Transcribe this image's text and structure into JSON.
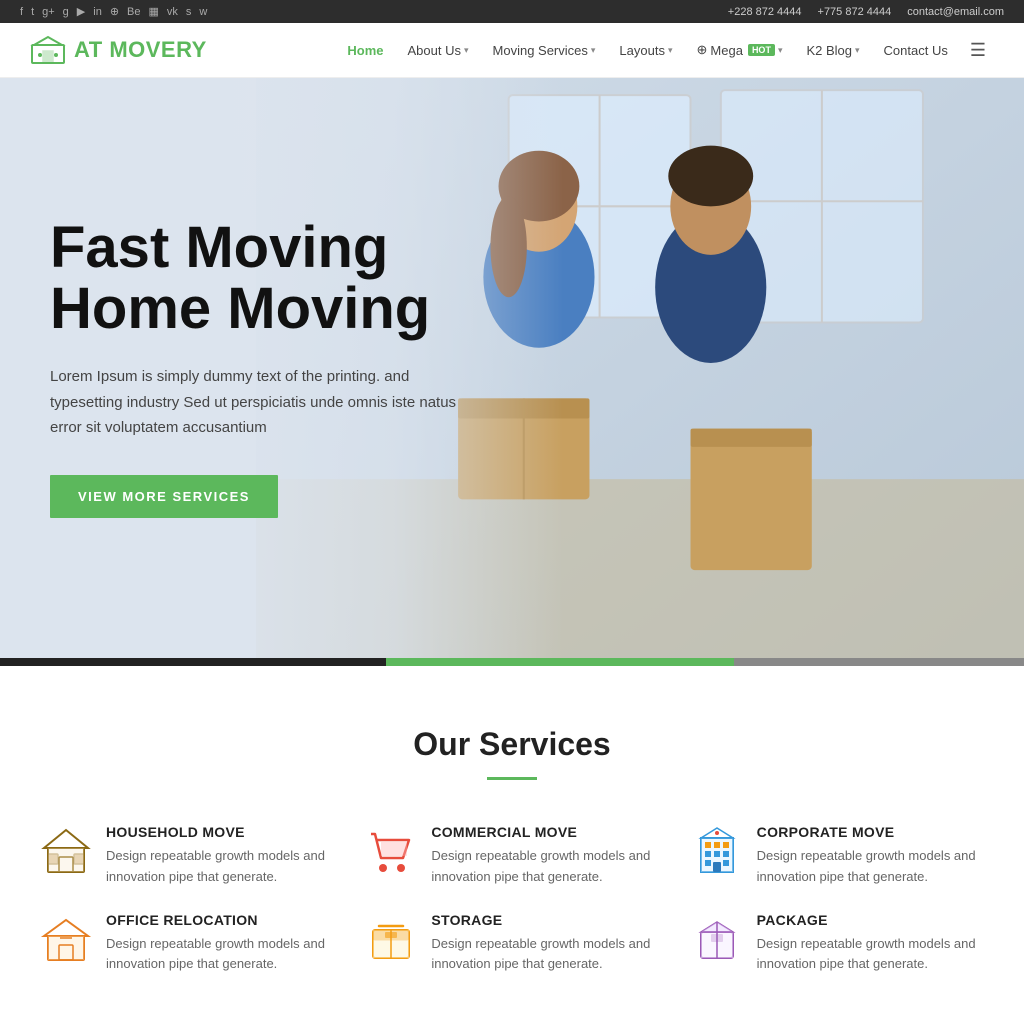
{
  "topbar": {
    "social_icons": [
      "f",
      "t",
      "g+",
      "g",
      "yt",
      "in",
      "inst",
      "be",
      "bb",
      "vk",
      "s",
      "wh"
    ],
    "phone1": "+228 872 4444",
    "phone2": "+775 872 4444",
    "email": "contact@email.com"
  },
  "header": {
    "logo_text_dark": "AT",
    "logo_text_green": "MOVERY",
    "nav": [
      {
        "label": "Home",
        "active": true,
        "has_dropdown": false
      },
      {
        "label": "About Us",
        "active": false,
        "has_dropdown": true
      },
      {
        "label": "Moving Services",
        "active": false,
        "has_dropdown": true
      },
      {
        "label": "Layouts",
        "active": false,
        "has_dropdown": true
      },
      {
        "label": "Mega",
        "active": false,
        "has_dropdown": true,
        "badge": "HOT"
      },
      {
        "label": "K2 Blog",
        "active": false,
        "has_dropdown": true
      },
      {
        "label": "Contact Us",
        "active": false,
        "has_dropdown": false
      }
    ]
  },
  "hero": {
    "title_line1": "Fast Moving",
    "title_line2": "Home Moving",
    "description": "Lorem Ipsum is simply dummy text of the printing. and typesetting industry Sed ut perspiciatis unde omnis iste natus error sit voluptatem accusantium",
    "button_label": "VIEW MORE SERVICES"
  },
  "services": {
    "section_title": "Our Services",
    "items": [
      {
        "id": "household-move",
        "icon": "🏠",
        "title": "HOUSEHOLD MOVE",
        "description": "Design repeatable growth models and innovation pipe that generate."
      },
      {
        "id": "commercial-move",
        "icon": "🛒",
        "title": "COMMERCIAL MOVE",
        "description": "Design repeatable growth models and innovation pipe that generate."
      },
      {
        "id": "corporate-move",
        "icon": "🏢",
        "title": "CORPORATE MOVE",
        "description": "Design repeatable growth models and innovation pipe that generate."
      },
      {
        "id": "office-relocation",
        "icon": "🏡",
        "title": "OFFICE RELOCATION",
        "description": "Design repeatable growth models and innovation pipe that generate."
      },
      {
        "id": "storage",
        "icon": "📦",
        "title": "STORAGE",
        "description": "Design repeatable growth models and innovation pipe that generate."
      },
      {
        "id": "package",
        "icon": "🎁",
        "title": "PACKAGE",
        "description": "Design repeatable growth models and innovation pipe that generate."
      }
    ]
  }
}
